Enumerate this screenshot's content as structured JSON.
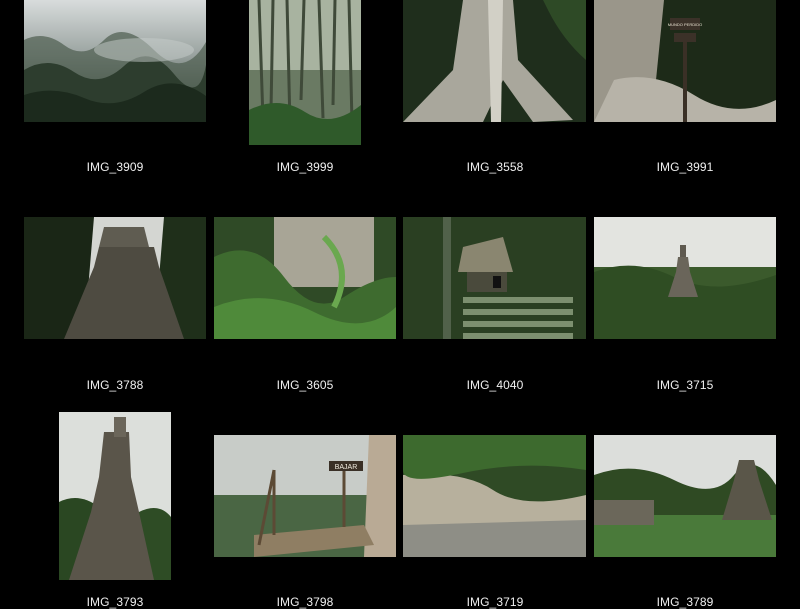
{
  "gallery": {
    "photos": [
      {
        "caption": "IMG_3909"
      },
      {
        "caption": "IMG_3999"
      },
      {
        "caption": "IMG_3558"
      },
      {
        "caption": "IMG_3991",
        "sign_text": "MUNDO PERDIDO"
      },
      {
        "caption": "IMG_3788"
      },
      {
        "caption": "IMG_3605"
      },
      {
        "caption": "IMG_4040"
      },
      {
        "caption": "IMG_3715"
      },
      {
        "caption": "IMG_3793"
      },
      {
        "caption": "IMG_3798",
        "sign_text": "BAJAR"
      },
      {
        "caption": "IMG_3719"
      },
      {
        "caption": "IMG_3789"
      }
    ]
  }
}
